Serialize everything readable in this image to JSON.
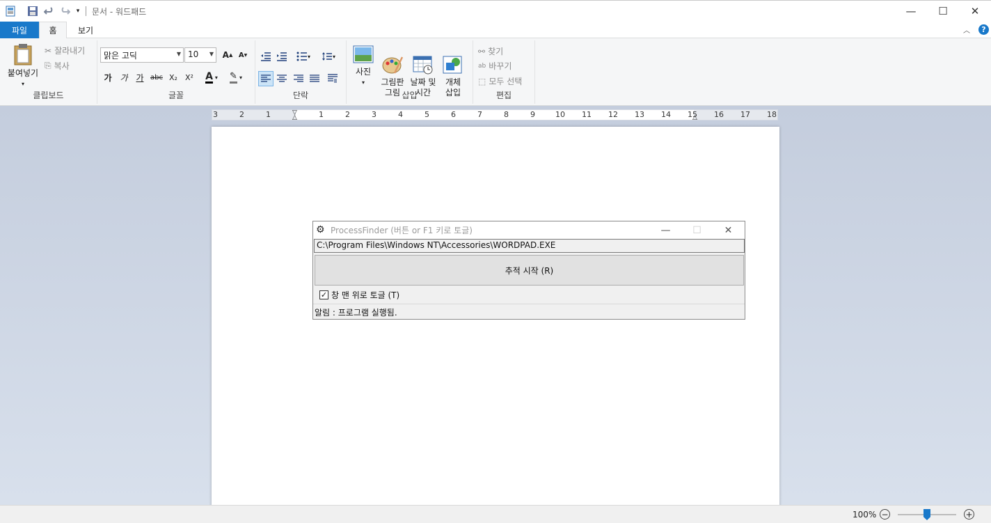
{
  "window": {
    "title": "문서 - 워드패드"
  },
  "tabs": [
    {
      "label": "파일"
    },
    {
      "label": "홈"
    },
    {
      "label": "보기"
    }
  ],
  "ribbon": {
    "clipboard": {
      "paste_label": "붙여넣기",
      "cut_label": "잘라내기",
      "copy_label": "복사",
      "group_label": "클립보드"
    },
    "font": {
      "family": "맑은 고딕",
      "size": "10",
      "group_label": "글꼴",
      "bold": "가",
      "italic": "가",
      "underline": "가",
      "strike": "abc",
      "sub": "X₂",
      "sup": "X²"
    },
    "paragraph": {
      "group_label": "단락"
    },
    "insert": {
      "picture_label": "사진",
      "paint_label": "그림판\n그림",
      "datetime_label": "날짜 및\n시간",
      "object_label": "개체\n삽입",
      "group_label": "삽입"
    },
    "editing": {
      "find_label": "찾기",
      "replace_label": "바꾸기",
      "select_all_label": "모두 선택",
      "group_label": "편집"
    }
  },
  "ruler": {
    "ticks": [
      "3",
      "2",
      "1",
      "1",
      "2",
      "3",
      "4",
      "5",
      "6",
      "7",
      "8",
      "9",
      "10",
      "11",
      "12",
      "13",
      "14",
      "15",
      "16",
      "17",
      "18"
    ]
  },
  "dialog": {
    "title": "ProcessFinder (버튼 or F1 키로 토글)",
    "path": "C:\\Program Files\\Windows NT\\Accessories\\WORDPAD.EXE",
    "track_button": "추적 시작 (R)",
    "topmost_label": "창 맨 위로 토글 (T)",
    "topmost_checked": true,
    "status": "알림 : 프로그램 실행됨."
  },
  "statusbar": {
    "zoom": "100%"
  }
}
